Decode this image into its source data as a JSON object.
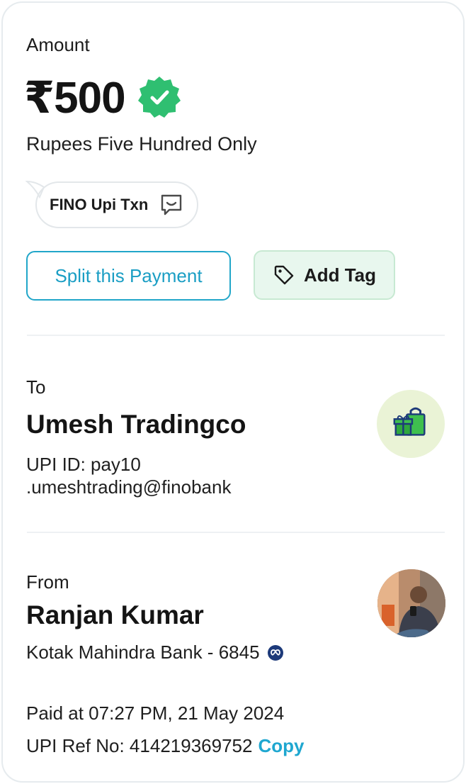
{
  "amount": {
    "label": "Amount",
    "value": "₹500",
    "in_words": "Rupees Five Hundred Only",
    "status_icon": "verified-badge-icon"
  },
  "note": {
    "text": "FINO Upi Txn",
    "icon": "chat-bubble-icon"
  },
  "actions": {
    "split_label": "Split this Payment",
    "tag_label": "Add Tag",
    "tag_icon": "tag-icon"
  },
  "to": {
    "label": "To",
    "name": "Umesh Tradingco",
    "upi_id_line1": "UPI ID: pay10",
    "upi_id_line2": ".umeshtrading@finobank",
    "avatar_icon": "shopping-gift-icon"
  },
  "from": {
    "label": "From",
    "name": "Ranjan Kumar",
    "bank": "Kotak Mahindra Bank - 6845",
    "bank_icon": "upi-link-icon"
  },
  "transaction": {
    "paid_at": "Paid at 07:27 PM, 21 May 2024",
    "ref_label": "UPI Ref No: 414219369752",
    "copy_label": "Copy"
  },
  "colors": {
    "accent_blue": "#1a9ec4",
    "success_green": "#2fbf71",
    "tag_bg": "#e8f7ee"
  }
}
